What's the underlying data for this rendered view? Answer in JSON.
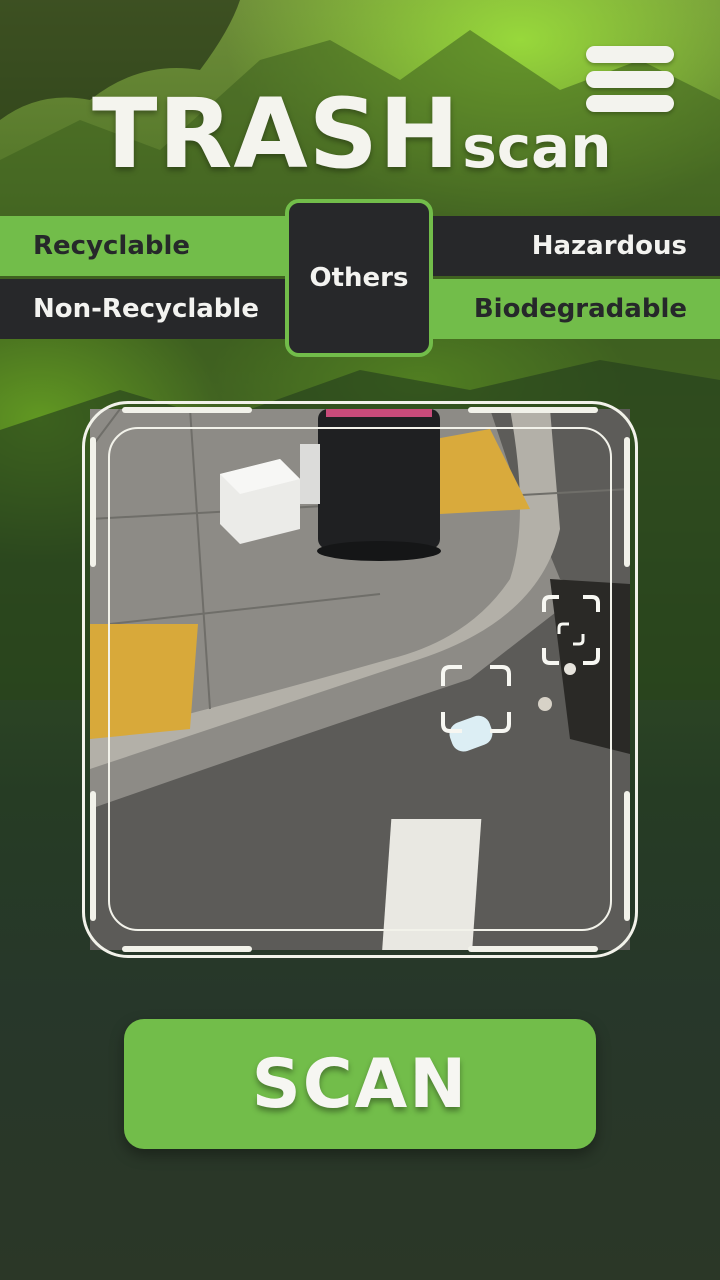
{
  "app": {
    "title_big": "TRASH",
    "title_small": "scan"
  },
  "categories": {
    "recyclable": "Recyclable",
    "non_recyclable": "Non-Recyclable",
    "others": "Others",
    "hazardous": "Hazardous",
    "biodegradable": "Biodegradable"
  },
  "scan_button": "SCAN",
  "icons": {
    "menu": "hamburger-menu-icon",
    "focus": "viewfinder-corner-icon"
  },
  "colors": {
    "accent_green": "#72bd4a",
    "dark": "#27282a",
    "light": "#f3f3ee"
  }
}
